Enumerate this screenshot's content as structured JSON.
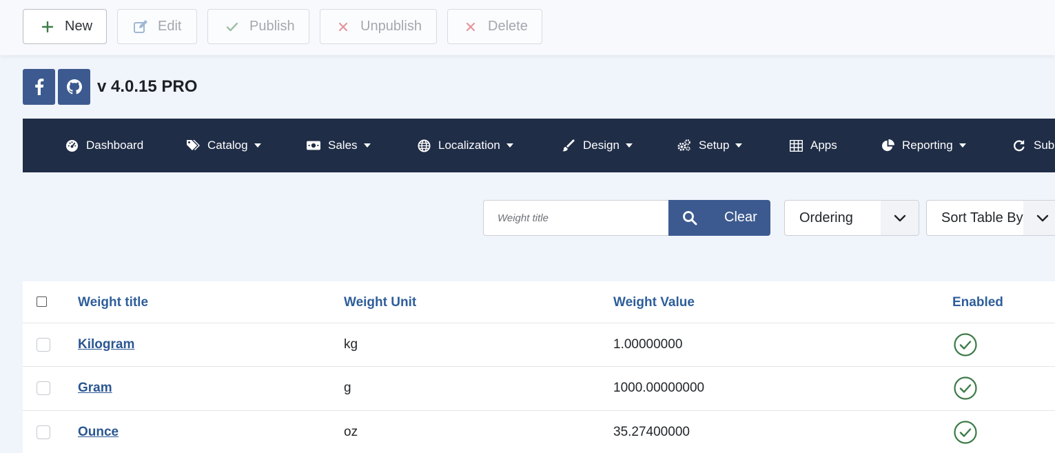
{
  "toolbar": {
    "new_label": "New",
    "edit_label": "Edit",
    "publish_label": "Publish",
    "unpublish_label": "Unpublish",
    "delete_label": "Delete"
  },
  "header": {
    "version": "v 4.0.15 PRO",
    "social_icons": [
      "facebook-icon",
      "github-icon"
    ]
  },
  "nav": {
    "items": [
      {
        "label": "Dashboard",
        "icon": "tachometer-icon",
        "dropdown": false
      },
      {
        "label": "Catalog",
        "icon": "tags-icon",
        "dropdown": true
      },
      {
        "label": "Sales",
        "icon": "money-bill-icon",
        "dropdown": true
      },
      {
        "label": "Localization",
        "icon": "globe-icon",
        "dropdown": true
      },
      {
        "label": "Design",
        "icon": "paintbrush-icon",
        "dropdown": true
      },
      {
        "label": "Setup",
        "icon": "cogs-icon",
        "dropdown": true
      },
      {
        "label": "Apps",
        "icon": "table-icon",
        "dropdown": false
      },
      {
        "label": "Reporting",
        "icon": "chart-pie-icon",
        "dropdown": true
      },
      {
        "label": "Subs",
        "icon": "redo-icon",
        "dropdown": false
      }
    ]
  },
  "filters": {
    "search_placeholder": "Weight title",
    "clear_label": "Clear",
    "ordering_value": "Ordering",
    "sort_value": "Sort Table By"
  },
  "table": {
    "headers": {
      "title": "Weight title",
      "unit": "Weight Unit",
      "value": "Weight Value",
      "enabled": "Enabled"
    },
    "rows": [
      {
        "title": "Kilogram",
        "unit": "kg",
        "value": "1.00000000",
        "enabled": true
      },
      {
        "title": "Gram",
        "unit": "g",
        "value": "1000.00000000",
        "enabled": true
      },
      {
        "title": "Ounce",
        "unit": "oz",
        "value": "35.27400000",
        "enabled": true
      }
    ]
  },
  "colors": {
    "primary": "#3c5a8f",
    "navbar": "#1f2d47",
    "link": "#2a5692",
    "success": "#3d7a47",
    "danger": "#d9534f"
  }
}
